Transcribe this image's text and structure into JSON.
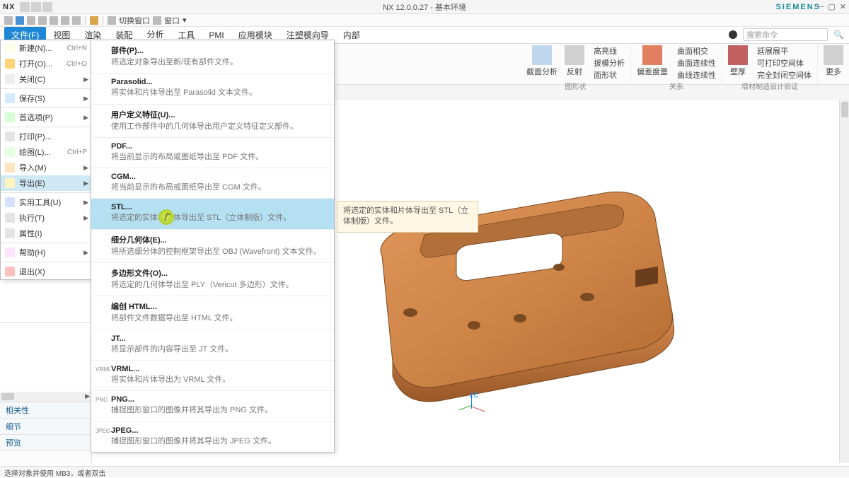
{
  "titlebar": {
    "logo": "NX",
    "center": "NX 12.0.0.27 - 基本环境",
    "brand": "SIEMENS"
  },
  "quickbar": {
    "switch_window": "切换窗口",
    "window": "窗口"
  },
  "menubar": {
    "file": "文件(F)",
    "items": [
      "视图",
      "渲染",
      "装配",
      "分析",
      "工具",
      "PMI",
      "应用模块",
      "注塑模向导",
      "内部"
    ],
    "search_placeholder": "搜索命令"
  },
  "ribbon": {
    "groups": {
      "analysis": {
        "section": "截面分析",
        "reflect": "反射",
        "label": "图形状"
      },
      "curve": {
        "hl": "高亮线",
        "pm": "拔模分析",
        "face": "面形状",
        "label": ""
      },
      "deviation": {
        "main": "偏差度量",
        "label": ""
      },
      "curve2": {
        "ci": "曲面相交",
        "cl": "曲面连续性",
        "cc": "曲线连续性",
        "label": "关系"
      },
      "thickness": {
        "main": "壁厚",
        "label": ""
      },
      "mfg": {
        "ext": "延展展平",
        "print": "可打印空间体",
        "full": "完全封闭空间体",
        "label": "增材制造设计验证"
      },
      "more": {
        "main": "更多"
      }
    }
  },
  "file_menu": [
    {
      "label": "新建(N)...",
      "shortcut": "Ctrl+N",
      "icon": "ic-new",
      "arrow": false
    },
    {
      "label": "打开(O)...",
      "shortcut": "Ctrl+O",
      "icon": "ic-open",
      "arrow": false
    },
    {
      "label": "关闭(C)",
      "shortcut": "",
      "icon": "ic-close",
      "arrow": true
    },
    {
      "sep": true
    },
    {
      "label": "保存(S)",
      "shortcut": "",
      "icon": "ic-save",
      "arrow": true
    },
    {
      "sep": true
    },
    {
      "label": "首选项(P)",
      "shortcut": "",
      "icon": "ic-pref",
      "arrow": true
    },
    {
      "sep": true
    },
    {
      "label": "打印(P)...",
      "shortcut": "",
      "icon": "ic-print",
      "arrow": false
    },
    {
      "label": "绘图(L)...",
      "shortcut": "Ctrl+P",
      "icon": "ic-plot",
      "arrow": false
    },
    {
      "label": "导入(M)",
      "shortcut": "",
      "icon": "ic-import",
      "arrow": true
    },
    {
      "label": "导出(E)",
      "shortcut": "",
      "icon": "ic-export",
      "arrow": true,
      "hl": true
    },
    {
      "sep": true
    },
    {
      "label": "实用工具(U)",
      "shortcut": "",
      "icon": "ic-util",
      "arrow": true
    },
    {
      "label": "执行(T)",
      "shortcut": "",
      "icon": "ic-exec",
      "arrow": true
    },
    {
      "label": "属性(I)",
      "shortcut": "",
      "icon": "ic-prop",
      "arrow": false
    },
    {
      "sep": true
    },
    {
      "label": "帮助(H)",
      "shortcut": "",
      "icon": "ic-help",
      "arrow": true
    },
    {
      "sep": true
    },
    {
      "label": "退出(X)",
      "shortcut": "",
      "icon": "ic-exit",
      "arrow": false
    }
  ],
  "export_menu": [
    {
      "title": "部件(P)...",
      "desc": "将选定对象导出至新/现有部件文件。"
    },
    {
      "title": "Parasolid...",
      "desc": "将实体和片体导出至 Parasolid 文本文件。"
    },
    {
      "title": "用户定义特征(U)...",
      "desc": "使用工作部件中的几何体导出用户定义特征定义部件。"
    },
    {
      "title": "PDF...",
      "desc": "将当前显示的布局或图纸导出至 PDF 文件。"
    },
    {
      "title": "CGM...",
      "desc": "将当前显示的布局或图纸导出至 CGM 文件。"
    },
    {
      "title": "STL...",
      "desc": "将选定的实体和片体导出至 STL（立体制版）文件。",
      "hl": true
    },
    {
      "title": "细分几何体(E)...",
      "desc": "将所选细分体的控制框架导出至 OBJ (Wavefront) 文本文件。"
    },
    {
      "title": "多边形文件(O)...",
      "desc": "将选定的几何体导出至 PLY（Vericut 多边形）文件。"
    },
    {
      "title": "编创 HTML...",
      "desc": "将部件文件数据导出至 HTML 文件。"
    },
    {
      "title": "JT...",
      "desc": "将显示部件的内容导出至 JT 文件。"
    },
    {
      "title": "VRML...",
      "desc": "将实体和片体导出为 VRML 文件。",
      "icon": "VRML"
    },
    {
      "title": "PNG...",
      "desc": "捕捉图形窗口的图像并将其导出为 PNG 文件。",
      "icon": "PNG"
    },
    {
      "title": "JPEG...",
      "desc": "捕捉图形窗口的图像并将其导出为 JPEG 文件。",
      "icon": "JPEG"
    }
  ],
  "tooltip": "将选定的实体和片体导出至 STL（立体制版）文件。",
  "left_tabs": [
    "相关性",
    "细节",
    "预览"
  ],
  "statusbar": "选择对象并使用 MB3，或者双击",
  "axis": {
    "z": "ZC"
  }
}
